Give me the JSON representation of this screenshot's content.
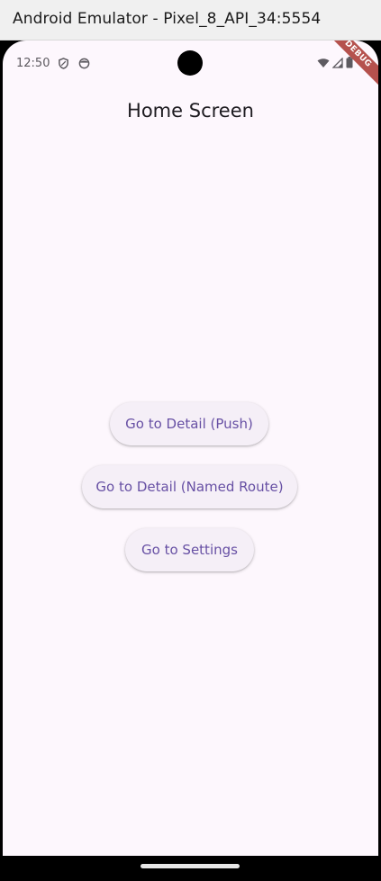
{
  "window": {
    "title": "Android Emulator - Pixel_8_API_34:5554"
  },
  "status_bar": {
    "time": "12:50",
    "left_icons": [
      "shield-icon",
      "face-icon"
    ],
    "right_icons": [
      "wifi-icon",
      "signal-icon",
      "battery-icon"
    ]
  },
  "debug_banner": {
    "label": "DEBUG"
  },
  "app_bar": {
    "title": "Home Screen"
  },
  "buttons": {
    "push_label": "Go to Detail (Push)",
    "named_label": "Go to Detail (Named Route)",
    "settings_label": "Go to Settings"
  },
  "colors": {
    "background": "#fdf7fd",
    "button_bg": "#f5eff7",
    "button_text": "#6750a4",
    "debug_ribbon": "#b5514d"
  }
}
